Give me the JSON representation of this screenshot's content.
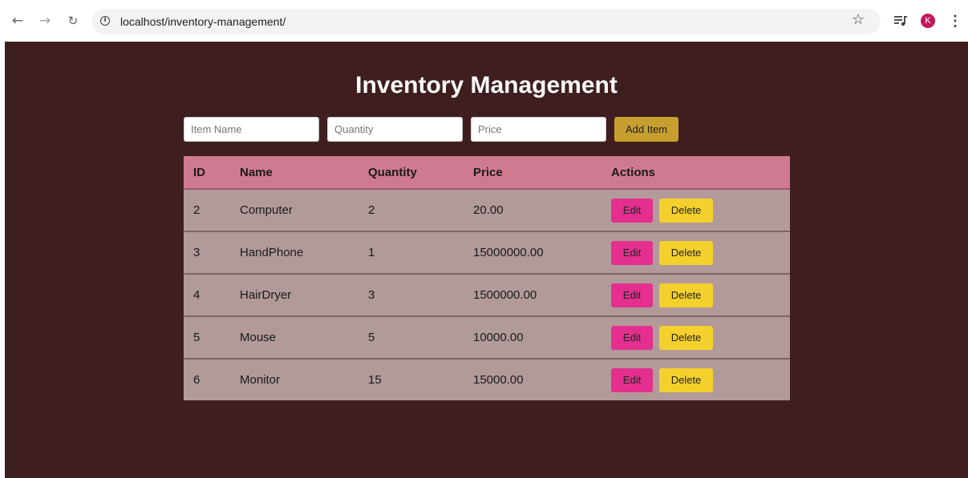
{
  "browser": {
    "url": "localhost/inventory-management/",
    "back_icon": "←",
    "forward_icon": "→",
    "reload_icon": "↻",
    "info_icon": "i",
    "star_icon": "☆",
    "avatar_letter": "K",
    "menu_icon": "⋮"
  },
  "page": {
    "title": "Inventory Management",
    "background_color": "#3f1e1f"
  },
  "form": {
    "item_name_placeholder": "Item Name",
    "quantity_placeholder": "Quantity",
    "price_placeholder": "Price",
    "add_button_label": "Add Item"
  },
  "table": {
    "headers": {
      "id": "ID",
      "name": "Name",
      "quantity": "Quantity",
      "price": "Price",
      "actions": "Actions"
    },
    "rows": [
      {
        "id": "2",
        "name": "Computer",
        "quantity": "2",
        "price": "20.00"
      },
      {
        "id": "3",
        "name": "HandPhone",
        "quantity": "1",
        "price": "15000000.00"
      },
      {
        "id": "4",
        "name": "HairDryer",
        "quantity": "3",
        "price": "1500000.00"
      },
      {
        "id": "5",
        "name": "Mouse",
        "quantity": "5",
        "price": "10000.00"
      },
      {
        "id": "6",
        "name": "Monitor",
        "quantity": "15",
        "price": "15000.00"
      }
    ],
    "edit_label": "Edit",
    "delete_label": "Delete"
  },
  "colors": {
    "header_bg": "#d07a91",
    "row_bg": "#b29a9a",
    "edit_button": "#e42f8e",
    "delete_button": "#f4d02c",
    "add_button": "#c89f2f"
  }
}
